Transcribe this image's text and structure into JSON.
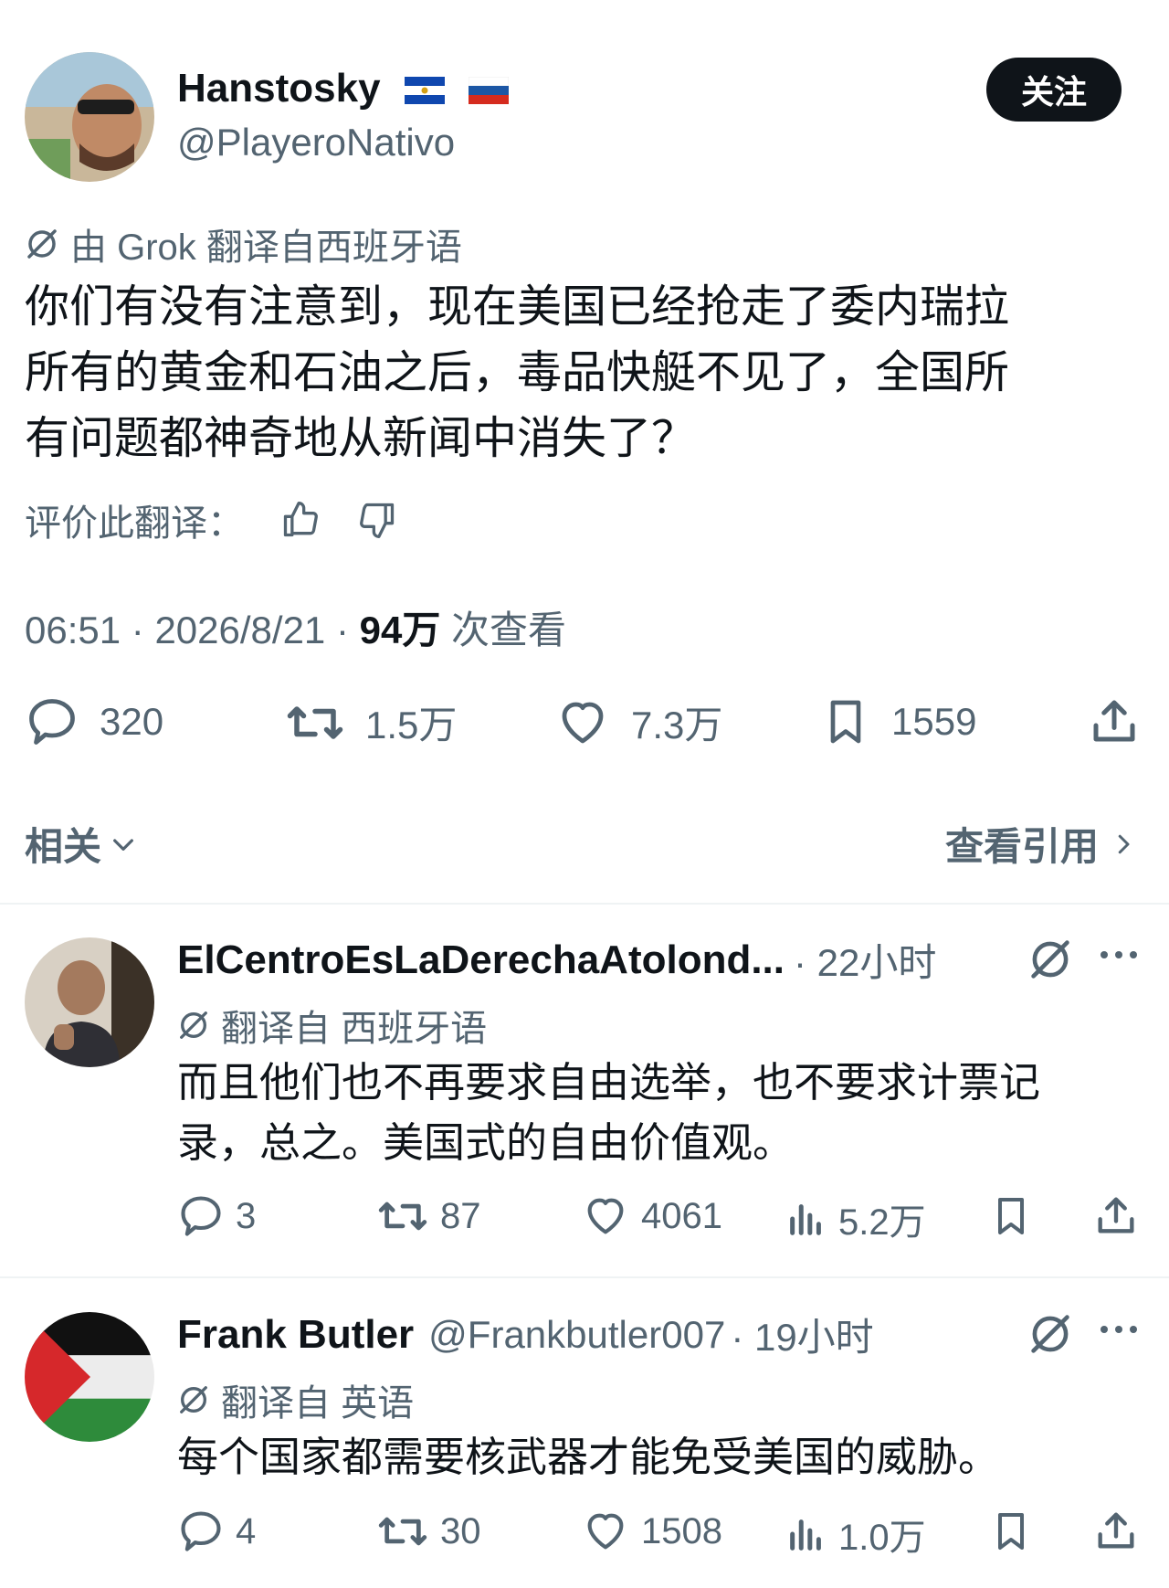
{
  "post": {
    "display_name": "Hanstosky",
    "flags": [
      "flag-el-salvador",
      "flag-russia"
    ],
    "handle": "@PlayeroNativo",
    "follow_label": "关注",
    "translate_notice": "由 Grok 翻译自西班牙语",
    "text_lines": [
      "你们有没有注意到，现在美国已经抢走了委内瑞拉",
      "所有的黄金和石油之后，毒品快艇不见了，全国所",
      "有问题都神奇地从新闻中消失了？"
    ],
    "rate_label": "评价此翻译：",
    "time": "06:51",
    "date": "2026/8/21",
    "views_value": "94万",
    "views_label": "次查看",
    "metrics": {
      "replies": "320",
      "reposts": "1.5万",
      "likes": "7.3万",
      "bookmarks": "1559"
    },
    "related_label": "相关",
    "quotes_label": "查看引用"
  },
  "replies": [
    {
      "display_name": "ElCentroEsLaDerechaAtolond...",
      "time": "· 22小时",
      "translate_notice": "翻译自 西班牙语",
      "text_lines": [
        "而且他们也不再要求自由选举，也不要求计票记",
        "录，总之。美国式的自由价值观。"
      ],
      "metrics": {
        "replies": "3",
        "reposts": "87",
        "likes": "4061",
        "views": "5.2万"
      }
    },
    {
      "display_name": "Frank Butler",
      "handle": "@Frankbutler007",
      "time": "· 19小时",
      "translate_notice": "翻译自 英语",
      "text_lines": [
        "每个国家都需要核武器才能免受美国的威胁。"
      ],
      "metrics": {
        "replies": "4",
        "reposts": "30",
        "likes": "1508",
        "views": "1.0万"
      }
    }
  ],
  "colors": {
    "text": "#0f1419",
    "muted": "#536471",
    "divider": "#eff3f4",
    "button_bg": "#0f1419"
  }
}
